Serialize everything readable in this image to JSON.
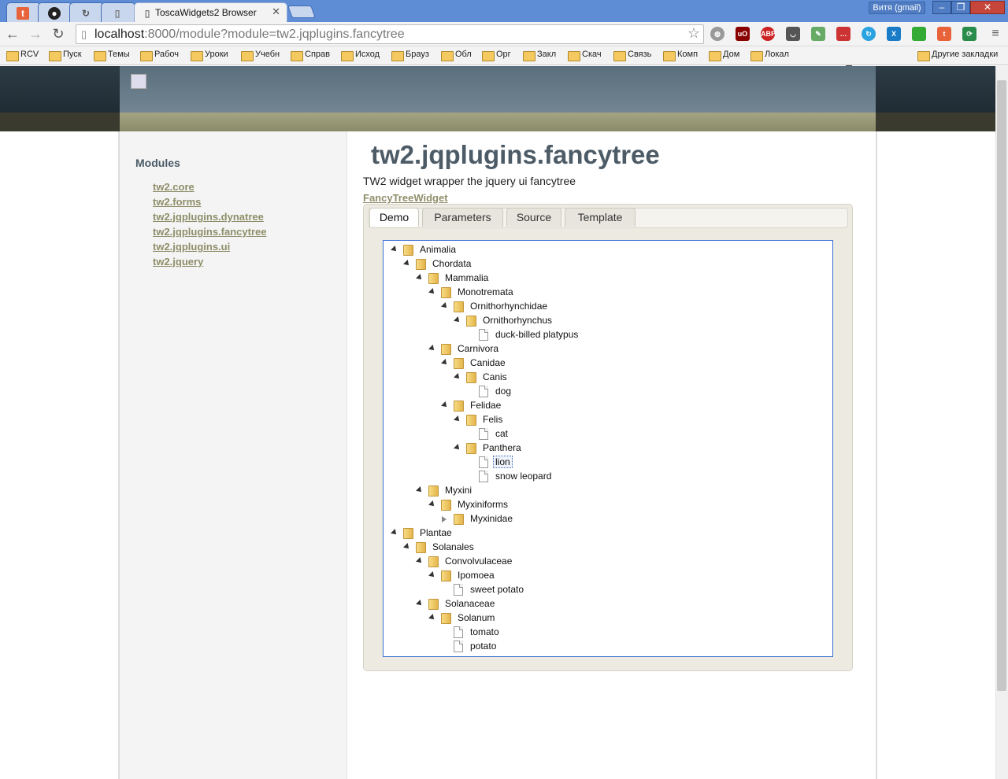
{
  "browser": {
    "tabs": [
      {
        "icon": "t",
        "title": ""
      },
      {
        "icon": "github",
        "title": ""
      },
      {
        "icon": "sync",
        "title": ""
      },
      {
        "icon": "page",
        "title": ""
      },
      {
        "icon": "page",
        "title": "ToscaWidgets2 Browser"
      }
    ],
    "user": "Витя (gmail)",
    "url_host": "localhost",
    "url_rest": ":8000/module?module=tw2.jqplugins.fancytree",
    "bookmarks": [
      "RCV",
      "Пуск",
      "Темы",
      "Рабоч",
      "Уроки",
      "Учебн",
      "Справ",
      "Исход",
      "Брауз",
      "Обл",
      "Орг",
      "Закл",
      "Скач",
      "Связь",
      "Комп",
      "Дом",
      "Локал"
    ],
    "other_bookmarks": "Другие закладки",
    "ext_badges": {
      "counter": "3",
      "abp": "ABP",
      "ub": "uO"
    }
  },
  "sidebar": {
    "title": "Modules",
    "links": [
      "tw2.core",
      "tw2.forms",
      "tw2.jqplugins.dynatree",
      "tw2.jqplugins.fancytree",
      "tw2.jqplugins.ui",
      "tw2.jquery"
    ]
  },
  "content": {
    "title": "tw2.jqplugins.fancytree",
    "description": "TW2 widget wrapper the jquery ui fancytree",
    "widget_link": "FancyTreeWidget",
    "tabs": [
      "Demo",
      "Parameters",
      "Source",
      "Template"
    ],
    "tree": [
      {
        "label": "Animalia",
        "depth": 0,
        "kind": "folder",
        "state": "expanded"
      },
      {
        "label": "Chordata",
        "depth": 1,
        "kind": "folder",
        "state": "expanded"
      },
      {
        "label": "Mammalia",
        "depth": 2,
        "kind": "folder",
        "state": "expanded"
      },
      {
        "label": "Monotremata",
        "depth": 3,
        "kind": "folder",
        "state": "expanded"
      },
      {
        "label": "Ornithorhynchidae",
        "depth": 4,
        "kind": "folder",
        "state": "expanded"
      },
      {
        "label": "Ornithorhynchus",
        "depth": 5,
        "kind": "folder",
        "state": "expanded"
      },
      {
        "label": "duck-billed platypus",
        "depth": 6,
        "kind": "doc"
      },
      {
        "label": "Carnivora",
        "depth": 3,
        "kind": "folder",
        "state": "expanded"
      },
      {
        "label": "Canidae",
        "depth": 4,
        "kind": "folder",
        "state": "expanded"
      },
      {
        "label": "Canis",
        "depth": 5,
        "kind": "folder",
        "state": "expanded"
      },
      {
        "label": "dog",
        "depth": 6,
        "kind": "doc"
      },
      {
        "label": "Felidae",
        "depth": 4,
        "kind": "folder",
        "state": "expanded"
      },
      {
        "label": "Felis",
        "depth": 5,
        "kind": "folder",
        "state": "expanded"
      },
      {
        "label": "cat",
        "depth": 6,
        "kind": "doc"
      },
      {
        "label": "Panthera",
        "depth": 5,
        "kind": "folder",
        "state": "expanded"
      },
      {
        "label": "lion",
        "depth": 6,
        "kind": "doc",
        "focused": true
      },
      {
        "label": "snow leopard",
        "depth": 6,
        "kind": "doc"
      },
      {
        "label": "Myxini",
        "depth": 2,
        "kind": "folder",
        "state": "expanded"
      },
      {
        "label": "Myxiniforms",
        "depth": 3,
        "kind": "folder",
        "state": "expanded"
      },
      {
        "label": "Myxinidae",
        "depth": 4,
        "kind": "folder",
        "state": "collapsed"
      },
      {
        "label": "Plantae",
        "depth": 0,
        "kind": "folder",
        "state": "expanded"
      },
      {
        "label": "Solanales",
        "depth": 1,
        "kind": "folder",
        "state": "expanded"
      },
      {
        "label": "Convolvulaceae",
        "depth": 2,
        "kind": "folder",
        "state": "expanded"
      },
      {
        "label": "Ipomoea",
        "depth": 3,
        "kind": "folder",
        "state": "expanded"
      },
      {
        "label": "sweet potato",
        "depth": 4,
        "kind": "doc"
      },
      {
        "label": "Solanaceae",
        "depth": 2,
        "kind": "folder",
        "state": "expanded"
      },
      {
        "label": "Solanum",
        "depth": 3,
        "kind": "folder",
        "state": "expanded"
      },
      {
        "label": "tomato",
        "depth": 4,
        "kind": "doc"
      },
      {
        "label": "potato",
        "depth": 4,
        "kind": "doc"
      }
    ]
  }
}
